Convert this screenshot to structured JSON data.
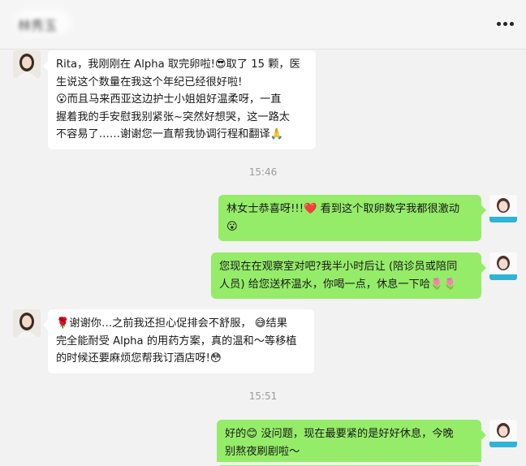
{
  "header": {
    "title": "林秀玉",
    "more_icon": "more-dots-icon"
  },
  "messages": [
    {
      "side": "left",
      "avatar": "contact-avatar",
      "lines": [
        "Rita，我刚刚在 Alpha 取完卵啦!😎取了 15 颗，医",
        "生说这个数量在我这个年纪已经很好啦!",
        "😮而且马来西亚这边护士小姐姐好温柔呀，一直",
        "握着我的手安慰我别紧张~突然好想哭，这一路太",
        "不容易了……谢谢您一直帮我协调行程和翻译🙏"
      ]
    },
    {
      "time": "15:46"
    },
    {
      "side": "right",
      "avatar": "own-avatar",
      "lines": [
        "林女士恭喜呀!!!❤️ 看到这个取卵数字我都很激动",
        "😮"
      ]
    },
    {
      "side": "right",
      "avatar": "own-avatar",
      "lines": [
        "您现在在观察室对吧?我半小时后让 (陪诊员或陪同",
        "人员) 给您送杯温水，你喝一点，休息一下哈🌷🌷"
      ]
    },
    {
      "side": "left",
      "avatar": "contact-avatar",
      "lines": [
        "🌹谢谢你…之前我还担心促排会不舒服， 😅结果",
        "完全能耐受 Alpha 的用药方案，真的温和～等移植",
        "的时候还要麻烦您帮我订酒店呀!😳"
      ]
    },
    {
      "time": "15:51"
    },
    {
      "side": "right",
      "avatar": "own-avatar",
      "lines": [
        "好的😊 没问题，现在最要紧的是好好休息，今晚",
        "别熬夜刷剧啦～"
      ]
    }
  ],
  "colors": {
    "background": "#f2f2f2",
    "bubble_self": "#95ec69",
    "bubble_other": "#ffffff",
    "time_text": "#9b9b9b"
  }
}
